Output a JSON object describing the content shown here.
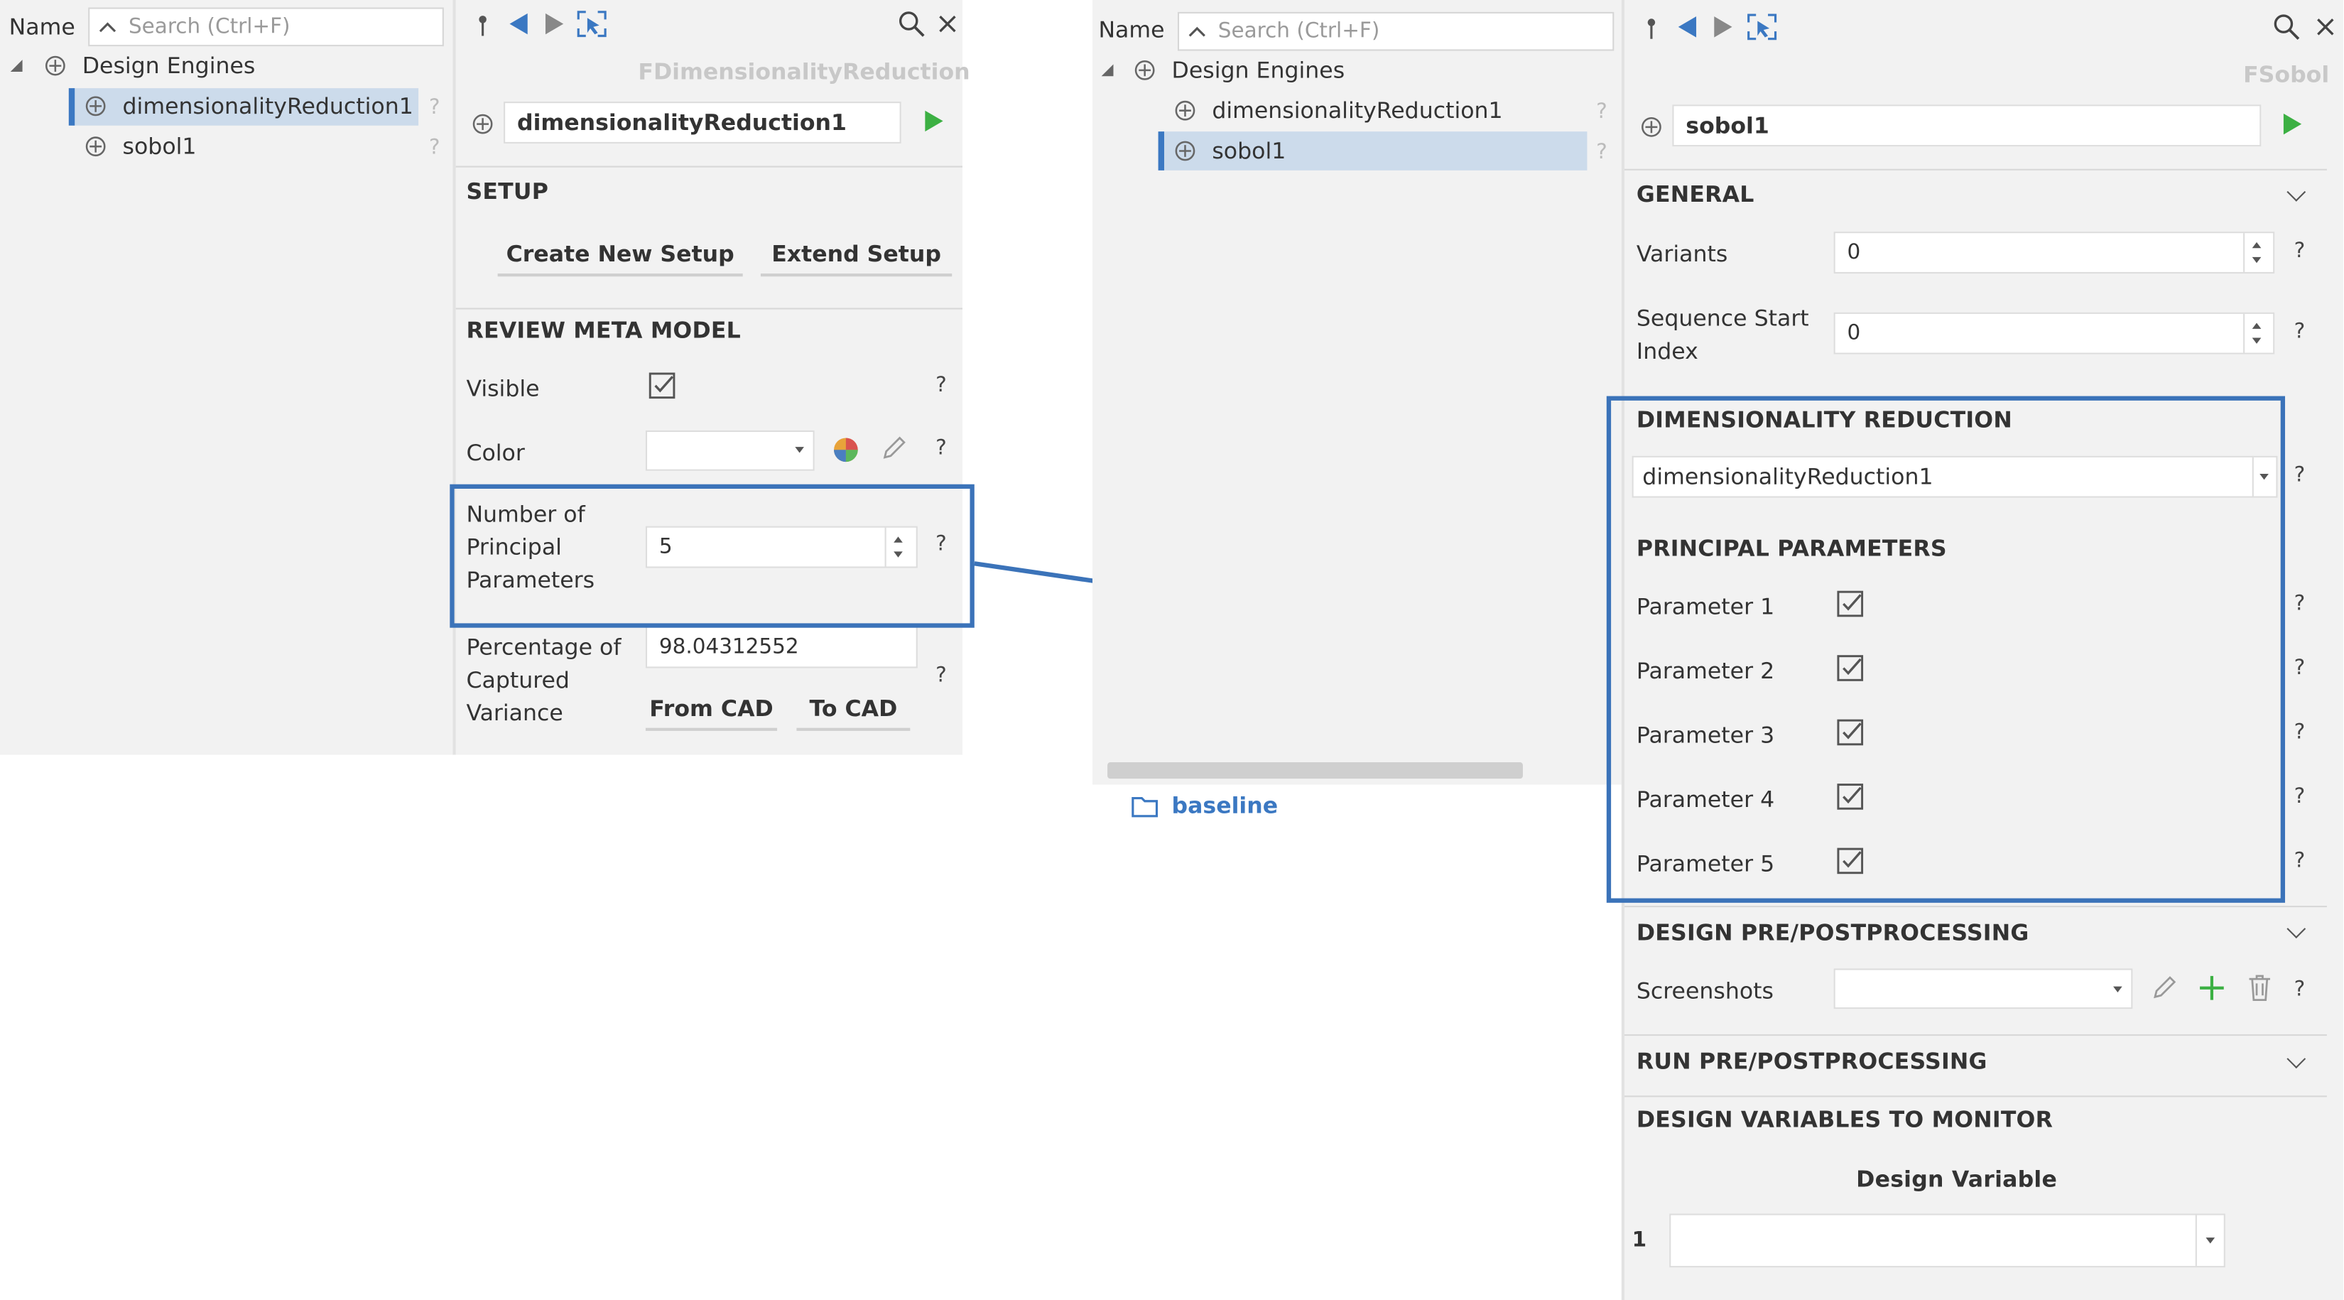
{
  "colors": {
    "accent": "#3b78c2",
    "highlight": "#3b73b9",
    "run_green": "#3cb043",
    "selection": "#ccdbeb"
  },
  "left_tree": {
    "name_header": "Name",
    "search_placeholder": "Search (Ctrl+F)",
    "root": "Design Engines",
    "items": [
      "dimensionalityReduction1",
      "sobol1"
    ],
    "selected": "dimensionalityReduction1",
    "help": "?"
  },
  "left_props": {
    "type_label": "FDimensionalityReduction",
    "name_value": "dimensionalityReduction1",
    "setup": {
      "title": "SETUP",
      "create_btn": "Create New Setup",
      "extend_btn": "Extend Setup"
    },
    "review": {
      "title": "REVIEW META MODEL",
      "visible_label": "Visible",
      "color_label": "Color",
      "num_principal_label": "Number of Principal Parameters",
      "num_principal_value": "5",
      "percentage_label": "Percentage of Captured Variance",
      "percentage_value": "98.04312552",
      "from_cad": "From CAD",
      "to_cad": "To CAD"
    },
    "help": "?"
  },
  "right_tree": {
    "name_header": "Name",
    "search_placeholder": "Search (Ctrl+F)",
    "root": "Design Engines",
    "items": [
      "dimensionalityReduction1",
      "sobol1"
    ],
    "selected": "sobol1",
    "baseline": "baseline",
    "help": "?"
  },
  "right_props": {
    "type_label": "FSobol",
    "name_value": "sobol1",
    "general": {
      "title": "GENERAL",
      "variants_label": "Variants",
      "variants_value": "0",
      "seq_label": "Sequence Start Index",
      "seq_value": "0"
    },
    "dimred": {
      "title": "DIMENSIONALITY REDUCTION",
      "value": "dimensionalityReduction1"
    },
    "principal": {
      "title": "PRINCIPAL PARAMETERS",
      "params": [
        "Parameter 1",
        "Parameter 2",
        "Parameter 3",
        "Parameter 4",
        "Parameter 5"
      ]
    },
    "design_pp": {
      "title": "DESIGN PRE/POSTPROCESSING",
      "screenshots_label": "Screenshots"
    },
    "run_pp": {
      "title": "RUN PRE/POSTPROCESSING"
    },
    "monitor": {
      "title": "DESIGN VARIABLES TO MONITOR",
      "column": "Design Variable",
      "row_index": "1"
    },
    "help": "?"
  }
}
